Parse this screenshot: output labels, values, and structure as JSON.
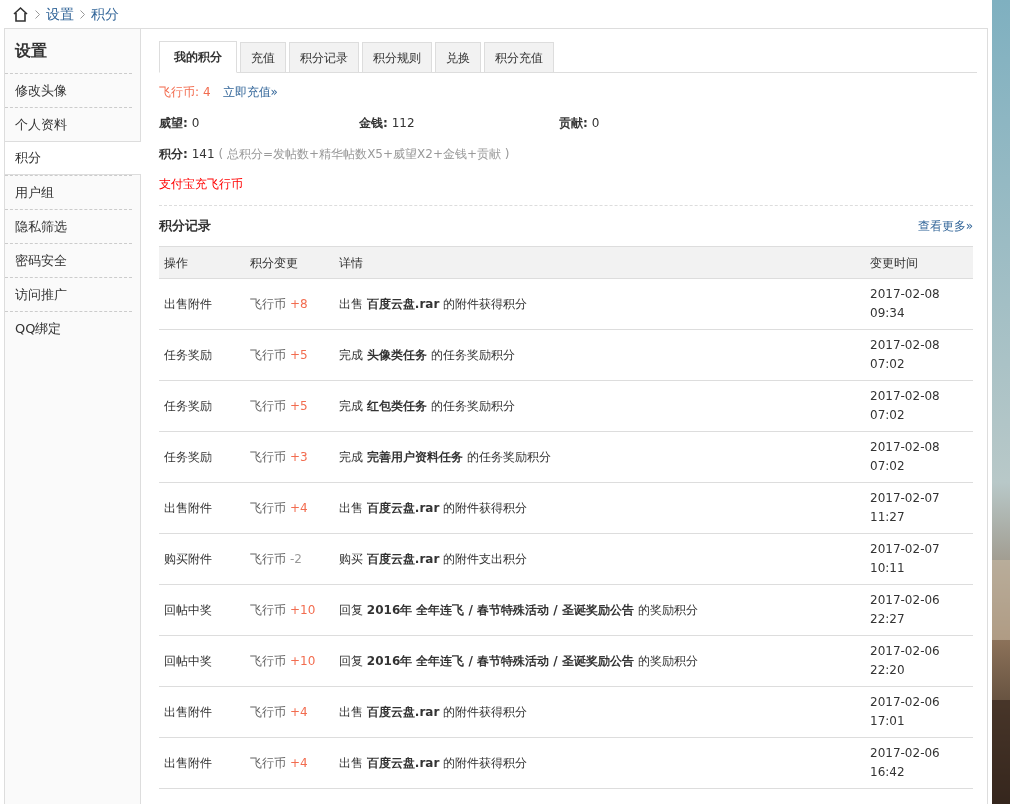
{
  "breadcrumb": [
    "设置",
    "积分"
  ],
  "sidebar": {
    "title": "设置",
    "items": [
      {
        "label": "修改头像",
        "selected": false
      },
      {
        "label": "个人资料",
        "selected": false
      },
      {
        "label": "积分",
        "selected": true
      },
      {
        "label": "用户组",
        "selected": false
      },
      {
        "label": "隐私筛选",
        "selected": false
      },
      {
        "label": "密码安全",
        "selected": false
      },
      {
        "label": "访问推广",
        "selected": false
      },
      {
        "label": "QQ绑定",
        "selected": false
      }
    ]
  },
  "tabs": [
    {
      "label": "我的积分",
      "selected": true
    },
    {
      "label": "充值",
      "selected": false
    },
    {
      "label": "积分记录",
      "selected": false
    },
    {
      "label": "积分规则",
      "selected": false
    },
    {
      "label": "兑换",
      "selected": false
    },
    {
      "label": "积分充值",
      "selected": false
    }
  ],
  "coins": {
    "label": "飞行币:",
    "value": "4",
    "link": "立即充值»"
  },
  "stats": [
    {
      "label": "威望:",
      "value": "0"
    },
    {
      "label": "金钱:",
      "value": "112"
    },
    {
      "label": "贡献:",
      "value": "0"
    }
  ],
  "total": {
    "label": "积分:",
    "value": "141",
    "formula": "( 总积分=发帖数+精华帖数X5+威望X2+金钱+贡献 )"
  },
  "alipay_link": "支付宝充飞行币",
  "records": {
    "title": "积分记录",
    "more": "查看更多»",
    "columns": [
      "操作",
      "积分变更",
      "详情",
      "变更时间"
    ],
    "rows": [
      {
        "action": "出售附件",
        "currency": "飞行币",
        "amount": "+8",
        "kind": "gain",
        "detail": "出售 **百度云盘.rar** 的附件获得积分",
        "date": "2017-02-08",
        "time": "09:34"
      },
      {
        "action": "任务奖励",
        "currency": "飞行币",
        "amount": "+5",
        "kind": "gain",
        "detail": "完成 **头像类任务** 的任务奖励积分",
        "date": "2017-02-08",
        "time": "07:02"
      },
      {
        "action": "任务奖励",
        "currency": "飞行币",
        "amount": "+5",
        "kind": "gain",
        "detail": "完成 **红包类任务** 的任务奖励积分",
        "date": "2017-02-08",
        "time": "07:02"
      },
      {
        "action": "任务奖励",
        "currency": "飞行币",
        "amount": "+3",
        "kind": "gain",
        "detail": "完成 **完善用户资料任务** 的任务奖励积分",
        "date": "2017-02-08",
        "time": "07:02"
      },
      {
        "action": "出售附件",
        "currency": "飞行币",
        "amount": "+4",
        "kind": "gain",
        "detail": "出售 **百度云盘.rar** 的附件获得积分",
        "date": "2017-02-07",
        "time": "11:27"
      },
      {
        "action": "购买附件",
        "currency": "飞行币",
        "amount": "-2",
        "kind": "loss",
        "detail": "购买 **百度云盘.rar** 的附件支出积分",
        "date": "2017-02-07",
        "time": "10:11"
      },
      {
        "action": "回帖中奖",
        "currency": "飞行币",
        "amount": "+10",
        "kind": "gain",
        "detail": "回复 **2016年 全年连飞 / 春节特殊活动 / 圣诞奖励公告** 的奖励积分",
        "date": "2017-02-06",
        "time": "22:27"
      },
      {
        "action": "回帖中奖",
        "currency": "飞行币",
        "amount": "+10",
        "kind": "gain",
        "detail": "回复 **2016年 全年连飞 / 春节特殊活动 / 圣诞奖励公告** 的奖励积分",
        "date": "2017-02-06",
        "time": "22:20"
      },
      {
        "action": "出售附件",
        "currency": "飞行币",
        "amount": "+4",
        "kind": "gain",
        "detail": "出售 **百度云盘.rar** 的附件获得积分",
        "date": "2017-02-06",
        "time": "17:01"
      },
      {
        "action": "出售附件",
        "currency": "飞行币",
        "amount": "+4",
        "kind": "gain",
        "detail": "出售 **百度云盘.rar** 的附件获得积分",
        "date": "2017-02-06",
        "time": "16:42"
      }
    ]
  }
}
